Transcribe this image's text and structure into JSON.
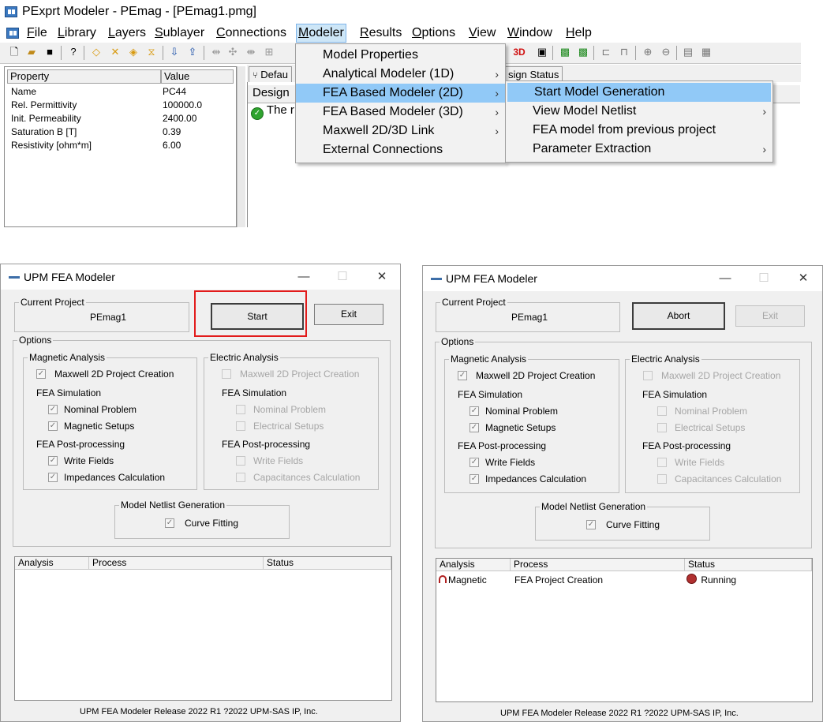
{
  "pexprt": {
    "title": "PExprt Modeler - PEmag - [PEmag1.pmg]",
    "menu": [
      {
        "label": "File",
        "u": "F",
        "rest": "ile"
      },
      {
        "label": "Library",
        "u": "L",
        "rest": "ibrary"
      },
      {
        "label": "Layers",
        "u": "L",
        "rest": "ayers"
      },
      {
        "label": "Sublayer",
        "u": "S",
        "rest": "ublayer"
      },
      {
        "label": "Connections",
        "u": "C",
        "rest": "onnections"
      },
      {
        "label": "Modeler",
        "u": "M",
        "rest": "odeler"
      },
      {
        "label": "Results",
        "u": "R",
        "rest": "esults"
      },
      {
        "label": "Options",
        "u": "O",
        "rest": "ptions"
      },
      {
        "label": "View",
        "u": "V",
        "rest": "iew"
      },
      {
        "label": "Window",
        "u": "W",
        "rest": "indow"
      },
      {
        "label": "Help",
        "u": "H",
        "rest": "elp"
      }
    ],
    "toolbar_text": {
      "label_3d": "3D"
    },
    "properties": {
      "headers": [
        "Property",
        "Value"
      ],
      "rows": [
        [
          "Name",
          "PC44"
        ],
        [
          "Rel. Permittivity",
          "100000.0"
        ],
        [
          "Init. Permeability",
          "2400.00"
        ],
        [
          "Saturation B [T]",
          "0.39"
        ],
        [
          "Resistivity [ohm*m]",
          "6.00"
        ]
      ]
    },
    "design": {
      "tab_left": "Defau",
      "tab_right": "sign Status",
      "header": "Design",
      "row_text": "The r"
    },
    "modeler_menu": [
      {
        "label": "Model Properties",
        "arrow": false
      },
      {
        "label": "Analytical Modeler (1D)",
        "arrow": true
      },
      {
        "label": "FEA Based Modeler (2D)",
        "arrow": true
      },
      {
        "label": "FEA Based Modeler (3D)",
        "arrow": true
      },
      {
        "label": "Maxwell 2D/3D Link",
        "arrow": true
      },
      {
        "label": "External Connections",
        "arrow": false
      }
    ],
    "fea2d_submenu": [
      {
        "label": "Start Model Generation",
        "arrow": false
      },
      {
        "label": "View Model Netlist",
        "arrow": true
      },
      {
        "label": "FEA model from previous project",
        "arrow": false
      },
      {
        "label": "Parameter Extraction",
        "arrow": true
      }
    ]
  },
  "dialog_left": {
    "title": "UPM FEA Modeler",
    "current_project_label": "Current Project",
    "project_name": "PEmag1",
    "start_button": "Start",
    "exit_button": "Exit",
    "options_label": "Options",
    "magnetic": {
      "label": "Magnetic Analysis",
      "maxwell": "Maxwell 2D Project Creation",
      "fea_sim": "FEA Simulation",
      "nominal": "Nominal Problem",
      "setups": "Magnetic Setups",
      "post": "FEA Post-processing",
      "write": "Write Fields",
      "imp": "Impedances Calculation"
    },
    "electric": {
      "label": "Electric Analysis",
      "maxwell": "Maxwell 2D Project Creation",
      "fea_sim": "FEA Simulation",
      "nominal": "Nominal Problem",
      "setups": "Electrical Setups",
      "post": "FEA Post-processing",
      "write": "Write Fields",
      "cap": "Capacitances Calculation"
    },
    "netlist": {
      "label": "Model Netlist Generation",
      "curve": "Curve Fitting"
    },
    "list_headers": [
      "Analysis",
      "Process",
      "Status"
    ],
    "footer": "UPM FEA Modeler Release 2022 R1 ?2022 UPM-SAS IP, Inc."
  },
  "dialog_right": {
    "title": "UPM FEA Modeler",
    "current_project_label": "Current Project",
    "project_name": "PEmag1",
    "abort_button": "Abort",
    "exit_button": "Exit",
    "options_label": "Options",
    "magnetic": {
      "label": "Magnetic Analysis",
      "maxwell": "Maxwell 2D Project Creation",
      "fea_sim": "FEA Simulation",
      "nominal": "Nominal Problem",
      "setups": "Magnetic Setups",
      "post": "FEA Post-processing",
      "write": "Write Fields",
      "imp": "Impedances Calculation"
    },
    "electric": {
      "label": "Electric Analysis",
      "maxwell": "Maxwell 2D Project Creation",
      "fea_sim": "FEA Simulation",
      "nominal": "Nominal Problem",
      "setups": "Electrical Setups",
      "post": "FEA Post-processing",
      "write": "Write Fields",
      "cap": "Capacitances Calculation"
    },
    "netlist": {
      "label": "Model Netlist Generation",
      "curve": "Curve Fitting"
    },
    "list_headers": [
      "Analysis",
      "Process",
      "Status"
    ],
    "list_rows": [
      {
        "analysis": "Magnetic",
        "process": "FEA Project Creation",
        "status": "Running"
      }
    ],
    "footer": "UPM FEA Modeler Release 2022 R1 ?2022 UPM-SAS IP, Inc."
  },
  "colors": {
    "highlight": "#91c9f7",
    "menu_open": "#cde6f7",
    "callout": "#e21b1b"
  }
}
